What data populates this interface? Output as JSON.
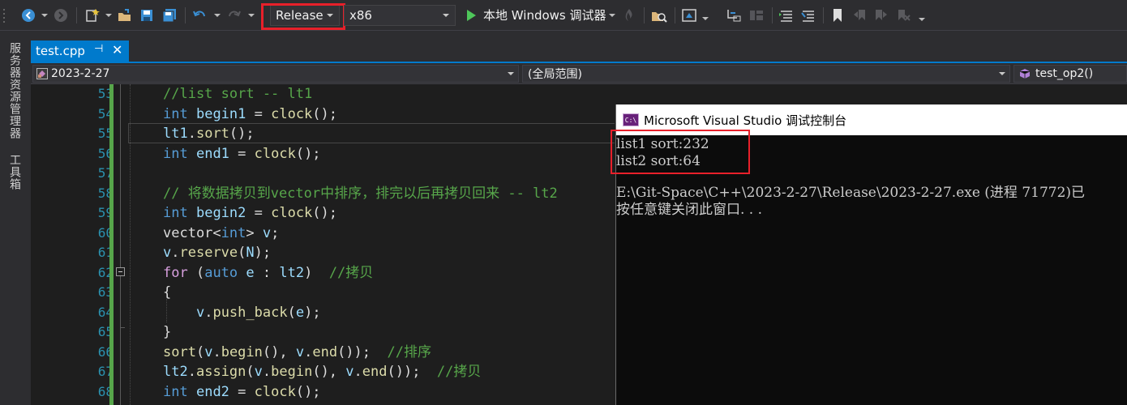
{
  "toolbar": {
    "configuration": "Release",
    "platform": "x86",
    "start_debugger": "本地 Windows 调试器",
    "highlight_color": "#e8202a",
    "icons": [
      "back-icon",
      "forward-icon",
      "new-project-icon",
      "open-folder-icon",
      "save-icon",
      "save-all-icon",
      "undo-icon",
      "redo-icon",
      "start-play-icon",
      "hot-reload-icon",
      "find-in-files-icon",
      "browse-icon",
      "step-into-icon",
      "breakpoint-layout-icon",
      "comment-icon",
      "uncomment-icon",
      "bookmark-icon",
      "prev-bookmark-icon",
      "next-bookmark-icon",
      "clear-bookmarks-icon"
    ]
  },
  "side_panel": {
    "tabs": [
      "服务器资源管理器",
      "工具箱"
    ]
  },
  "document_tab": {
    "name": "test.cpp",
    "pin": "⊣",
    "close": "✕"
  },
  "nav_bar": {
    "project": "2023-2-27",
    "scope": "(全局范围)",
    "member": "test_op2()"
  },
  "editor": {
    "line_numbers": [
      "53",
      "54",
      "55",
      "56",
      "57",
      "58",
      "59",
      "60",
      "61",
      "62",
      "63",
      "64",
      "65",
      "66",
      "67",
      "68"
    ],
    "lines": [
      "//list sort -- lt1",
      "int begin1 = clock();",
      "lt1.sort();",
      "int end1 = clock();",
      "",
      "// 将数据拷贝到vector中排序，排完以后再拷贝回来 -- lt2",
      "int begin2 = clock();",
      "vector<int> v;",
      "v.reserve(N);",
      "for (auto e : lt2)  //拷贝",
      "{",
      "    v.push_back(e);",
      "}",
      "sort(v.begin(), v.end());  //排序",
      "lt2.assign(v.begin(), v.end());  //拷贝",
      "int end2 = clock();"
    ]
  },
  "console": {
    "title": "Microsoft Visual Studio 调试控制台",
    "icon_text": "C:\\",
    "output": [
      "list1 sort:232",
      "list2 sort:64",
      "",
      "E:\\Git-Space\\C++\\2023-2-27\\Release\\2023-2-27.exe (进程 71772)已",
      "按任意键关闭此窗口. . ."
    ]
  }
}
